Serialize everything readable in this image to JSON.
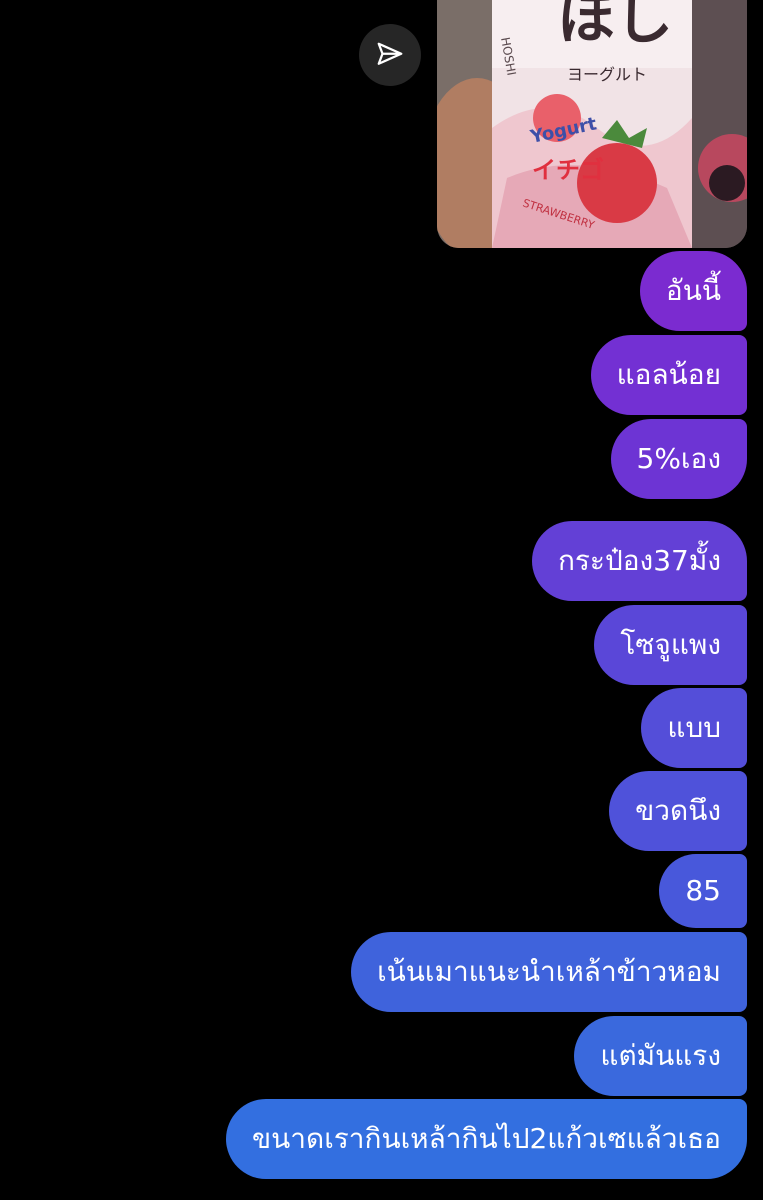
{
  "chat": {
    "photo": {
      "can_brand_glyphs": "ほし",
      "can_brand_latin": "HOSHI",
      "can_subtitle_kana": "ヨーグルト",
      "can_flavor_latin": "Yogurt",
      "can_flavor_kana": "イチゴ",
      "can_flavor_en": "STRAWBERRY"
    },
    "share_icon": "paper-plane-icon",
    "messages": [
      {
        "text": "อันนี้",
        "color": "#7b2bd0"
      },
      {
        "text": "แอลน้อย",
        "color": "#7330d3"
      },
      {
        "text": "5%เอง",
        "color": "#6d34d4"
      },
      {
        "text": "กระป๋อง37มั้ง",
        "color": "#6340d6"
      },
      {
        "text": "โซจูแพง",
        "color": "#5a47d8"
      },
      {
        "text": "แบบ",
        "color": "#544ed9"
      },
      {
        "text": "ขวดนึง",
        "color": "#4f52da"
      },
      {
        "text": "85",
        "color": "#4858db"
      },
      {
        "text": "เน้นเมาแนะนำเหล้าข้าวหอม",
        "color": "#3f63dc"
      },
      {
        "text": "แต่มันแรง",
        "color": "#3a69dd"
      },
      {
        "text": "ขนาดเรากินเหล้ากินไป2แก้วเซแล้วเธอ",
        "color": "#336fe0"
      }
    ]
  }
}
